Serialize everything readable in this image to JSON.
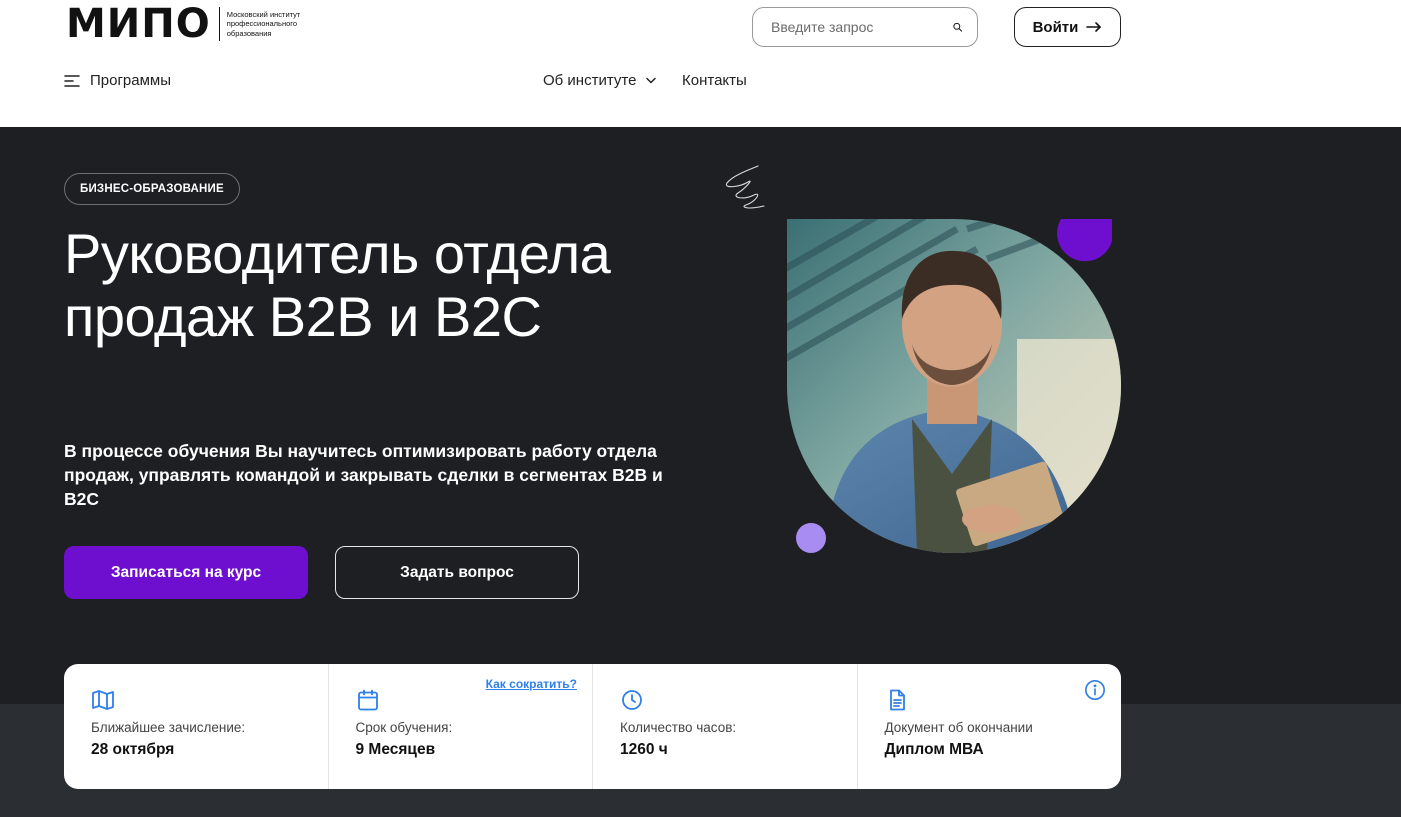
{
  "header": {
    "logo_text": "МИПО",
    "logo_subtitle": "Московский институт профессионального образования",
    "search_placeholder": "Введите запрос",
    "login_label": "Войти",
    "nav": {
      "programs": "Программы",
      "about": "Об институте",
      "contacts": "Контакты"
    }
  },
  "hero": {
    "badge": "БИЗНЕС-ОБРАЗОВАНИЕ",
    "title": "Руководитель отдела продаж В2В и В2С",
    "description": "В процессе обучения Вы научитесь оптимизировать работу отдела продаж, управлять командой и закрывать сделки в сегментах В2В и В2С",
    "primary_button": "Записаться на курс",
    "secondary_button": "Задать вопрос"
  },
  "info": {
    "shorten_link": "Как сократить?",
    "items": [
      {
        "icon": "map-icon",
        "label": "Ближайшее зачисление:",
        "value": "28 октября"
      },
      {
        "icon": "calendar-icon",
        "label": "Срок обучения:",
        "value": "9 Месяцев"
      },
      {
        "icon": "clock-icon",
        "label": "Количество часов:",
        "value": "1260 ч"
      },
      {
        "icon": "document-icon",
        "label": "Документ об окончании",
        "value": "Диплом МВА"
      }
    ]
  },
  "colors": {
    "accent_purple": "#6e0fd0",
    "dark_bg": "#1e1f23",
    "link_blue": "#2f80e8",
    "lavender_dot": "#a98cf2"
  }
}
